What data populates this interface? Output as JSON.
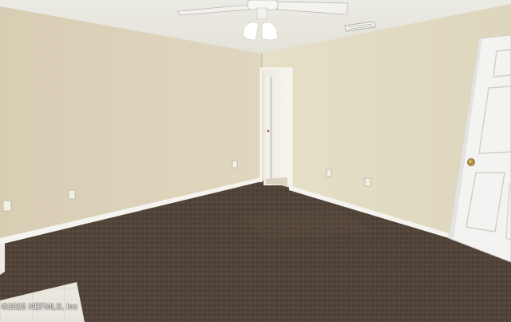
{
  "watermark": {
    "text": "©2025 NEFMLS, Inc"
  },
  "colors": {
    "left_wall": "#dcd2ba",
    "right_wall": "#e2dcc3",
    "back_wall": "#d6ceb6",
    "ceiling": "#ecebe4",
    "carpet": "#4f4238",
    "baseboard": "#f4f3ee",
    "door": "#f3f3f1"
  }
}
